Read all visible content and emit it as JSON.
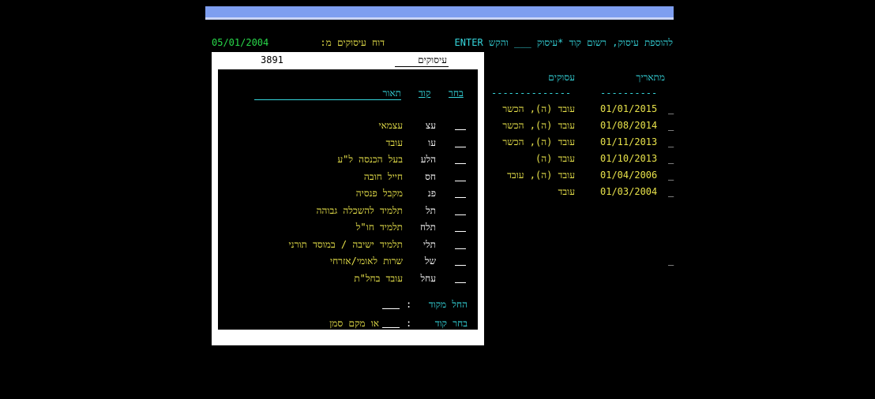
{
  "header": {
    "prompt": "להוספת עיסוק, רשום קוד *עיסוק ___ והקש ENTER",
    "report_label": "דוח עיסוקים מ:",
    "report_date": "05/01/2004"
  },
  "history": {
    "col_date": "מתאריך",
    "col_occupations": "עסוקים",
    "dashes_occ": "--------------",
    "dashes_date": "----------",
    "rows": [
      {
        "date": "01/01/2015",
        "occ": "עובד (ה), הכשר"
      },
      {
        "date": "01/08/2014",
        "occ": "עובד (ה), הכשר"
      },
      {
        "date": "01/11/2013",
        "occ": "עובד (ה), הכשר"
      },
      {
        "date": "01/10/2013",
        "occ": "עובד (ה)"
      },
      {
        "date": "01/04/2006",
        "occ": "עובד (ה), עובד"
      },
      {
        "date": "01/03/2004",
        "occ": "עובד"
      }
    ]
  },
  "popup": {
    "title": "עיסוקים",
    "number": "3891",
    "col_select": "בחר",
    "col_code": "קוד",
    "col_desc": "תאור",
    "items": [
      {
        "code": "עצ",
        "desc": "עצמאי"
      },
      {
        "code": "עו",
        "desc": "עובד"
      },
      {
        "code": "הלע",
        "desc": "בעל הכנסה ל\"ע"
      },
      {
        "code": "חס",
        "desc": "חייל חובה"
      },
      {
        "code": "פנ",
        "desc": "מקבל פנסיה"
      },
      {
        "code": "תל",
        "desc": "תלמיד להשכלה גבוהה"
      },
      {
        "code": "תלח",
        "desc": "תלמיד חו\"ל"
      },
      {
        "code": "תלי",
        "desc": "תלמיד ישיבה / במוסד תורני"
      },
      {
        "code": "של",
        "desc": "שרות לאומי/אזרחי"
      },
      {
        "code": "עחל",
        "desc": "עובד בחל\"ת"
      }
    ],
    "start_from_label": "החל מקוד",
    "choose_code_label": "בחר קוד",
    "or_mark_label": "או מקם סמן",
    "colon": ":"
  },
  "colors": {
    "cyan": "#35d6dc",
    "yellow": "#e8e24a",
    "green": "#28d84a",
    "banner": "#7e9ef0"
  }
}
